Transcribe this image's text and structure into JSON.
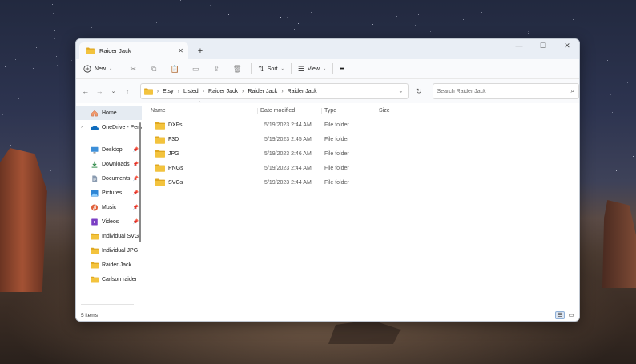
{
  "window": {
    "tab_title": "Raider Jack",
    "new_tab": "+",
    "minimize": "—",
    "maximize": "☐",
    "close": "✕"
  },
  "toolbar": {
    "new_label": "New",
    "sort_label": "Sort",
    "view_label": "View",
    "more_label": "•••"
  },
  "address": {
    "crumbs": [
      "Etsy",
      "Listed",
      "Raider Jack",
      "Raider Jack",
      "Raider Jack"
    ],
    "search_placeholder": "Search Raider Jack"
  },
  "nav": {
    "items": [
      {
        "label": "Home",
        "icon": "home-icon"
      },
      {
        "label": "OneDrive - Pers",
        "icon": "cloud-icon"
      },
      {
        "label": "Desktop",
        "icon": "desktop-icon"
      },
      {
        "label": "Downloads",
        "icon": "download-icon"
      },
      {
        "label": "Documents",
        "icon": "document-icon"
      },
      {
        "label": "Pictures",
        "icon": "pictures-icon"
      },
      {
        "label": "Music",
        "icon": "music-icon"
      },
      {
        "label": "Videos",
        "icon": "videos-icon"
      },
      {
        "label": "Individual SVG",
        "icon": "folder-icon"
      },
      {
        "label": "Individual JPG",
        "icon": "folder-icon"
      },
      {
        "label": "Raider Jack",
        "icon": "folder-icon"
      },
      {
        "label": "Carlson raider",
        "icon": "folder-icon"
      }
    ]
  },
  "columns": {
    "name": "Name",
    "date": "Date modified",
    "type": "Type",
    "size": "Size"
  },
  "files": [
    {
      "name": "DXFs",
      "date": "5/19/2023 2:44 AM",
      "type": "File folder"
    },
    {
      "name": "F3D",
      "date": "5/19/2023 2:45 AM",
      "type": "File folder"
    },
    {
      "name": "JPG",
      "date": "5/19/2023 2:46 AM",
      "type": "File folder"
    },
    {
      "name": "PNGs",
      "date": "5/19/2023 2:44 AM",
      "type": "File folder"
    },
    {
      "name": "SVGs",
      "date": "5/19/2023 2:44 AM",
      "type": "File folder"
    }
  ],
  "status": {
    "item_count": "5 items"
  },
  "colors": {
    "folder": "#f3c33d",
    "folder_dark": "#e0a820",
    "accent": "#0067c0"
  }
}
